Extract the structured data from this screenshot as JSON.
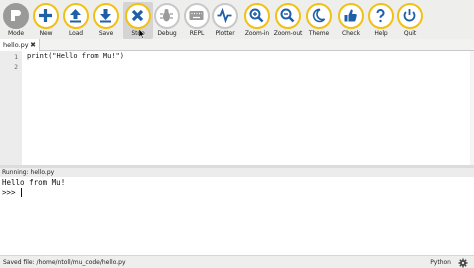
{
  "toolbar": {
    "mode": "Mode",
    "new": "New",
    "load": "Load",
    "save": "Save",
    "stop": "Stop",
    "debug": "Debug",
    "repl": "REPL",
    "plotter": "Plotter",
    "zoom_in": "Zoom-in",
    "zoom_out": "Zoom-out",
    "theme": "Theme",
    "check": "Check",
    "help": "Help",
    "quit": "Quit"
  },
  "tabs": [
    {
      "label": "hello.py",
      "close": "✖"
    }
  ],
  "editor": {
    "line_numbers": [
      "1",
      "2"
    ],
    "lines": [
      "print(\"Hello from Mu!\")",
      ""
    ]
  },
  "repl": {
    "header": "Running: hello.py",
    "output": [
      "Hello from Mu!",
      ">>> "
    ]
  },
  "statusbar": {
    "message": "Saved file: /home/ntoll/mu_code/hello.py",
    "mode": "Python"
  },
  "colors": {
    "accent": "#f2c014",
    "icon": "#1f5fa8",
    "toolbar_bg": "#eeeeec",
    "mode_button": "#9a9a9a",
    "disabled_ring": "#c8c8c8"
  },
  "icons": {
    "mode": "mode-icon",
    "new": "plus-icon",
    "load": "upload-icon",
    "save": "download-icon",
    "stop": "close-icon",
    "debug": "bug-icon",
    "repl": "keyboard-icon",
    "plotter": "waveform-icon",
    "zoom_in": "zoom-in-icon",
    "zoom_out": "zoom-out-icon",
    "theme": "moon-icon",
    "check": "thumbs-up-icon",
    "help": "question-icon",
    "quit": "power-icon"
  }
}
